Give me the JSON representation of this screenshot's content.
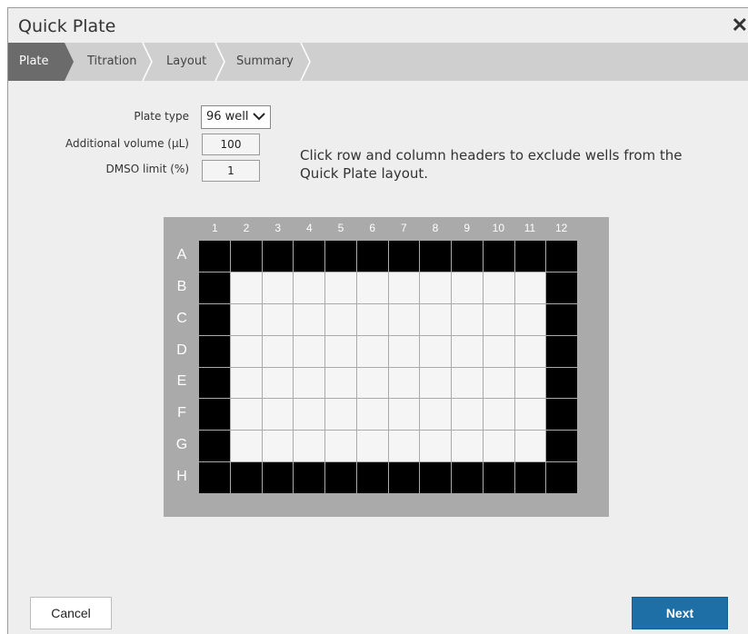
{
  "dialog": {
    "title": "Quick Plate",
    "close_icon": "close-icon"
  },
  "tabs": [
    {
      "label": "Plate",
      "active": true
    },
    {
      "label": "Titration",
      "active": false
    },
    {
      "label": "Layout",
      "active": false
    },
    {
      "label": "Summary",
      "active": false
    }
  ],
  "form": {
    "plate_type_label": "Plate type",
    "plate_type_value": "96 well",
    "additional_volume_label": "Additional volume (µL)",
    "additional_volume_value": "100",
    "dmso_limit_label": "DMSO limit (%)",
    "dmso_limit_value": "1"
  },
  "hint": "Click row and column headers to exclude wells from the Quick Plate layout.",
  "plate": {
    "columns": [
      "1",
      "2",
      "3",
      "4",
      "5",
      "6",
      "7",
      "8",
      "9",
      "10",
      "11",
      "12"
    ],
    "rows": [
      "A",
      "B",
      "C",
      "D",
      "E",
      "F",
      "G",
      "H"
    ],
    "excluded_rows": [
      "A",
      "H"
    ],
    "excluded_columns": [
      "1",
      "12"
    ]
  },
  "buttons": {
    "cancel": "Cancel",
    "next": "Next"
  },
  "colors": {
    "active_tab": "#6b6b6b",
    "tab_bar": "#cfcfcf",
    "next_button": "#1d6fa5",
    "excluded_well": "#000000",
    "included_well": "#f5f5f5"
  }
}
